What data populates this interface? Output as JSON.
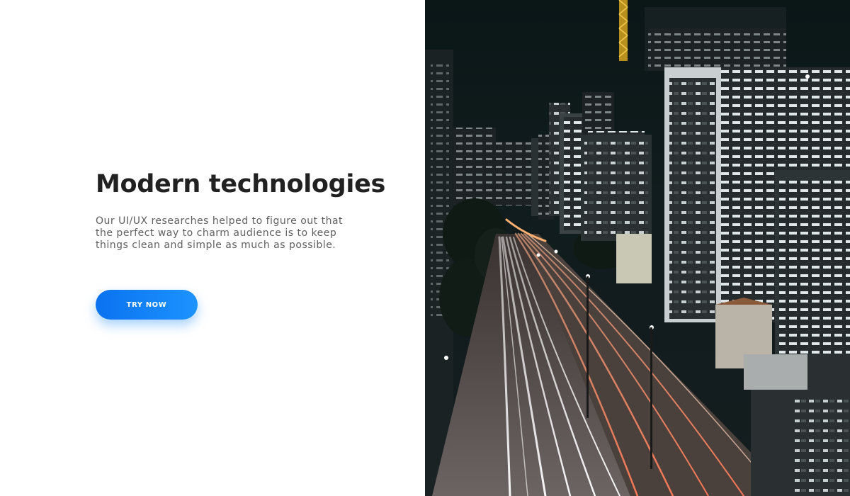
{
  "hero": {
    "title": "Modern technologies",
    "description": "Our UI/UX researches helped to figure out that the perfect way to charm audience is to keep things clean and simple as much as possible.",
    "cta_label": "TRY NOW"
  },
  "colors": {
    "title": "#212121",
    "body_text": "#5f5f5f",
    "button_start": "#0a72f0",
    "button_end": "#1d93ff",
    "button_text": "#ffffff",
    "photo_sky": "#0d1718"
  },
  "photo": {
    "subject": "night-city-street-long-exposure"
  }
}
